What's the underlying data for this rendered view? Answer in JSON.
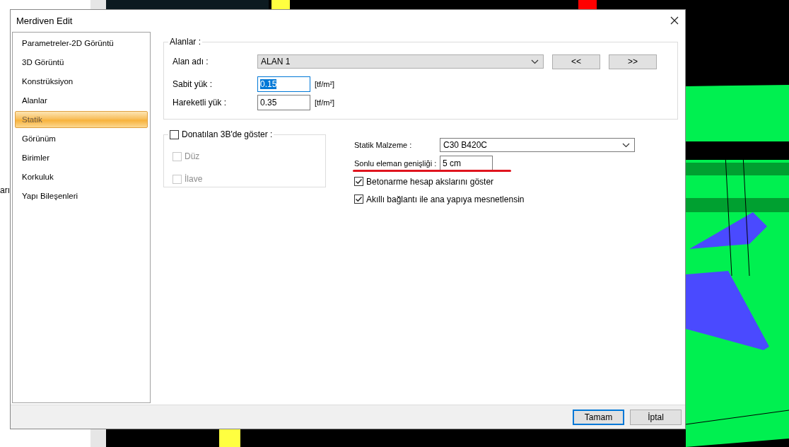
{
  "background": {
    "edge_text": "arı"
  },
  "window": {
    "title": "Merdiven Edit"
  },
  "sidebar": {
    "items": [
      {
        "label": "Parametreler-2D Görüntü",
        "selected": false
      },
      {
        "label": "3D Görüntü",
        "selected": false
      },
      {
        "label": "Konstrüksiyon",
        "selected": false
      },
      {
        "label": "Alanlar",
        "selected": false
      },
      {
        "label": "Statik",
        "selected": true
      },
      {
        "label": "Görünüm",
        "selected": false
      },
      {
        "label": "Birimler",
        "selected": false
      },
      {
        "label": "Korkuluk",
        "selected": false
      },
      {
        "label": "Yapı Bileşenleri",
        "selected": false
      }
    ]
  },
  "areas_group": {
    "legend": "Alanlar :",
    "area_name": {
      "label": "Alan adı :",
      "value": "ALAN 1"
    },
    "nav_buttons": [
      "<<",
      ">>"
    ],
    "loads": [
      {
        "label": "Sabit yük :",
        "value": "0.15",
        "unit": "[tf/m²]",
        "focused": true
      },
      {
        "label": "Hareketli yük :",
        "value": "0.35",
        "unit": "[tf/m²]",
        "focused": false
      }
    ]
  },
  "rebar_group": {
    "label": "Donatılan 3B'de göster :",
    "checked": false,
    "options": [
      {
        "label": "Düz",
        "checked": false,
        "disabled": true
      },
      {
        "label": "İlave",
        "checked": false,
        "disabled": true
      }
    ]
  },
  "static": {
    "material": {
      "label": "Statik Malzeme :",
      "value": "C30 B420C"
    },
    "element_width": {
      "label": "Sonlu eleman genişliği :",
      "value": "5 cm",
      "highlighted": true
    },
    "options": [
      {
        "label": "Betonarme hesap akslarını göster",
        "checked": true
      },
      {
        "label": "Akıllı bağlantı ile ana yapıya mesnetlensin",
        "checked": true
      }
    ]
  },
  "buttons": [
    {
      "label": "Tamam",
      "default": true
    },
    {
      "label": "İptal",
      "default": false
    }
  ]
}
